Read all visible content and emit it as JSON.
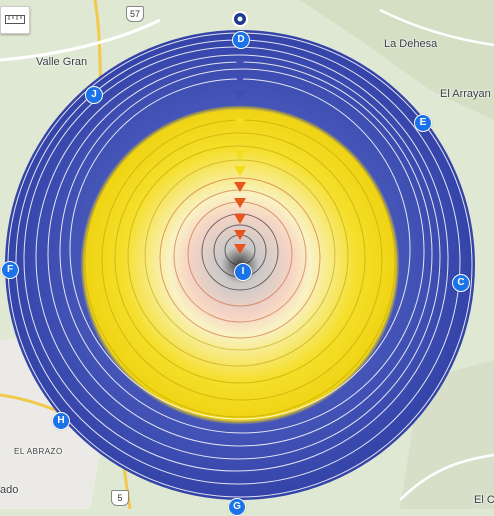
{
  "map": {
    "place_labels": {
      "valle_grande": "Valle Gran",
      "la_dehesa": "La Dehesa",
      "el_arrayan": "El Arrayan",
      "el_abrazo": "EL ABRAZO",
      "ado": "ado",
      "el_c": "El C"
    },
    "route_shields": {
      "route_57": "57",
      "route_5": "5"
    },
    "markers": {
      "D": "D",
      "E": "E",
      "J": "J",
      "F": "F",
      "C": "C",
      "H": "H",
      "I": "I",
      "G": "G"
    },
    "colors": {
      "outer_ring": "#3d4fb0",
      "middle_ring": "#f3dd1e",
      "inner_ring": "#e8541c",
      "center": "#2a2a2a",
      "marker": "#1a73e8"
    },
    "icons": {
      "measure_tool": "ruler-icon"
    }
  }
}
